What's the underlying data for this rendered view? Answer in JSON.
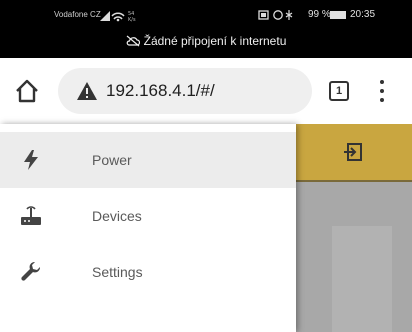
{
  "status_bar": {
    "carrier": "Vodafone CZ",
    "battery": "99 %",
    "time": "20:35",
    "no_internet": "Žádné připojení k internetu"
  },
  "browser": {
    "url": "192.168.4.1/#/",
    "tab_count": "1"
  },
  "drawer": {
    "items": [
      {
        "label": "Power",
        "icon": "bolt-icon",
        "active": true
      },
      {
        "label": "Devices",
        "icon": "router-icon",
        "active": false
      },
      {
        "label": "Settings",
        "icon": "wrench-icon",
        "active": false
      }
    ]
  },
  "colors": {
    "app_bar": "#c9a640",
    "active_item_bg": "#ececec",
    "overlay": "#a8a8a8"
  }
}
